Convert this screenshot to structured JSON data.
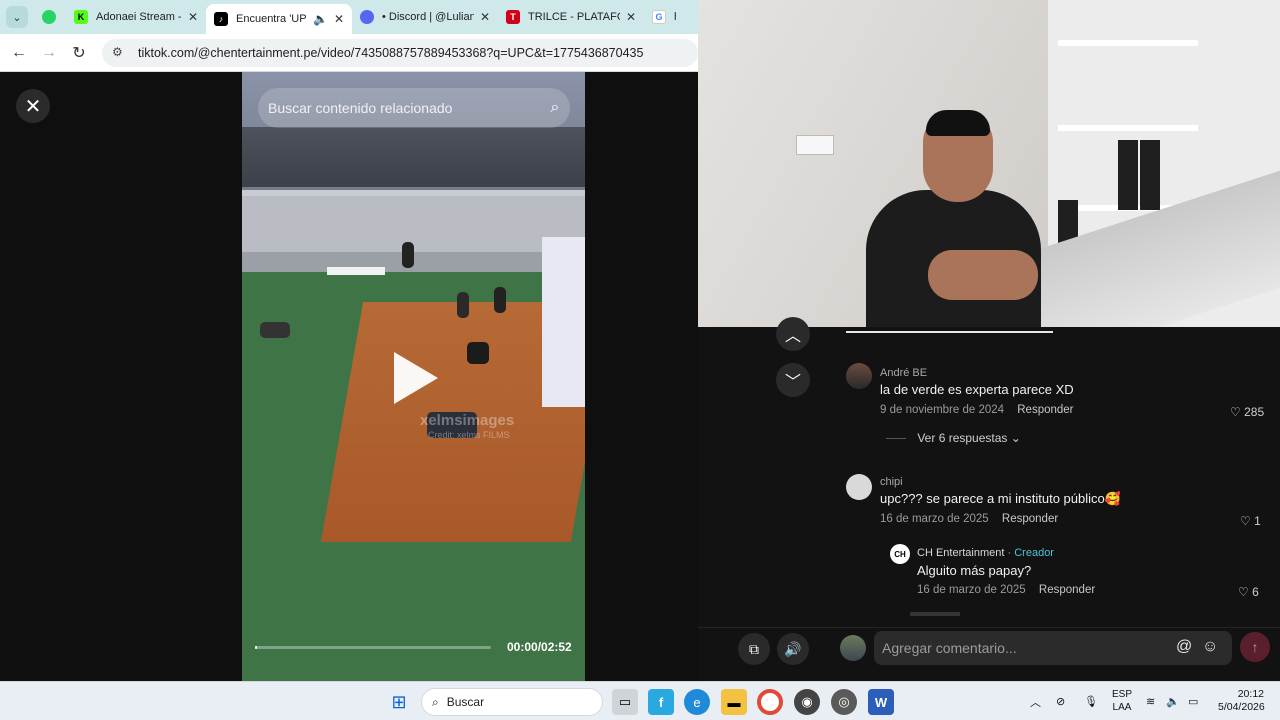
{
  "browser": {
    "tabs": [
      {
        "label": "",
        "icon": "whatsapp-icon",
        "color": "#25d366"
      },
      {
        "label": "Adonaei Stream - W",
        "icon": "kick-icon",
        "color": "#53fc18"
      },
      {
        "label": "Encuentra 'UPC",
        "icon": "tiktok-icon",
        "color": "#000000",
        "active": true
      },
      {
        "label": "• Discord | @Luliand",
        "icon": "discord-icon",
        "color": "#5865f2"
      },
      {
        "label": "TRILCE - PLATAFOR",
        "icon": "trilce-icon",
        "color": "#d0021b"
      },
      {
        "label": "ho",
        "icon": "google-icon",
        "color": "#4285f4"
      }
    ],
    "url": "tiktok.com/@chentertainment.pe/video/7435088757889453368?q=UPC&t=1775436870435"
  },
  "video": {
    "search_placeholder": "Buscar contenido relacionado",
    "watermark": "xelmsimages",
    "watermark_credit": "Credit: xelms FILMS",
    "time": "00:00/02:52",
    "progress": 0.01
  },
  "comments": [
    {
      "user": "André BE",
      "text": "la de verde es experta parece XD",
      "date": "9 de noviembre de 2024",
      "reply_label": "Responder",
      "likes": "285",
      "view_replies": "Ver 6 respuestas"
    },
    {
      "user": "chipi",
      "text": "upc??? se parece a mi instituto público🥰",
      "date": "16 de marzo de 2025",
      "reply_label": "Responder",
      "likes": "1",
      "reply": {
        "user": "CH Entertainment",
        "badge": "Creador",
        "text": "Alguito más papay?",
        "date": "16 de marzo de 2025",
        "reply_label": "Responder",
        "likes": "6"
      }
    }
  ],
  "comment_input": {
    "placeholder": "Agregar comentario..."
  },
  "taskbar": {
    "search_label": "Buscar",
    "lang_top": "ESP",
    "lang_bottom": "LAA",
    "time": "20:12",
    "date": "5/04/2026"
  }
}
